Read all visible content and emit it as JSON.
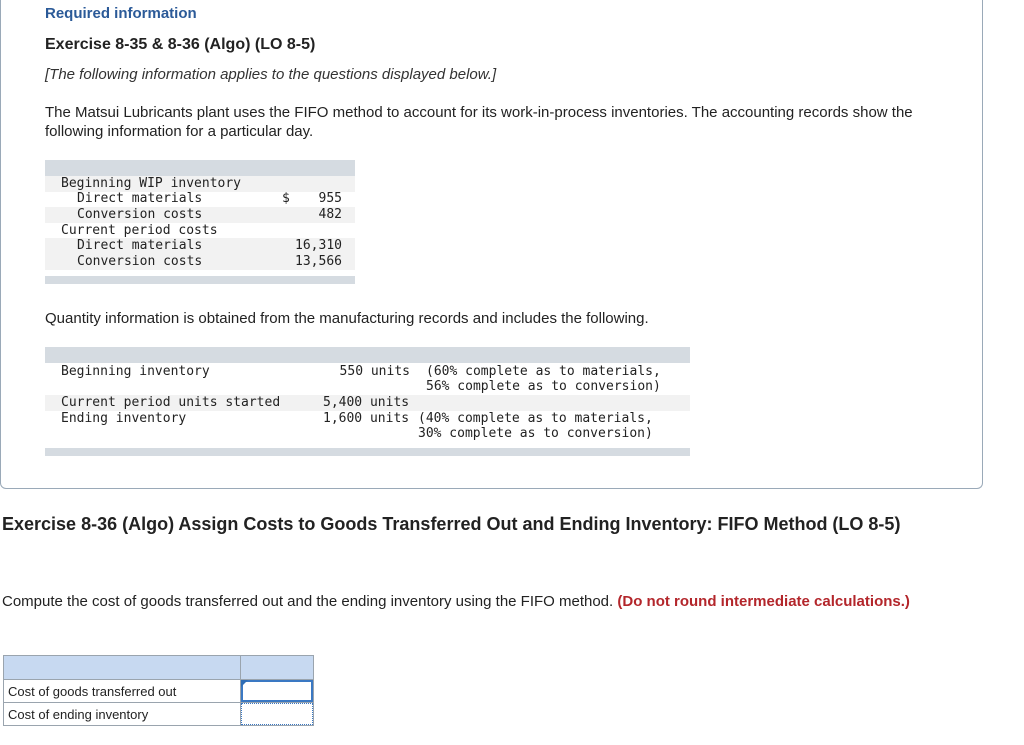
{
  "info": {
    "required_label": "Required information",
    "exercise_title": "Exercise 8-35 & 8-36 (Algo) (LO 8-5)",
    "applies_note": "[The following information applies to the questions displayed below.]",
    "intro": "The Matsui Lubricants plant uses the FIFO method to account for its work-in-process inventories. The accounting records show the following information for a particular day."
  },
  "cost_table": {
    "rows": [
      {
        "label": "Beginning WIP inventory",
        "currency": "",
        "value": ""
      },
      {
        "label": "Direct materials",
        "currency": "$",
        "value": "955"
      },
      {
        "label": "Conversion costs",
        "currency": "",
        "value": "482"
      },
      {
        "label": "Current period costs",
        "currency": "",
        "value": ""
      },
      {
        "label": "Direct materials",
        "currency": "",
        "value": "16,310"
      },
      {
        "label": "Conversion costs",
        "currency": "",
        "value": "13,566"
      }
    ]
  },
  "quantity_intro": "Quantity information is obtained from the manufacturing records and includes the following.",
  "qty_table": {
    "rows": [
      {
        "label": "Beginning inventory",
        "qty": "550 units",
        "note1": "(60% complete as to materials,",
        "note2": "56% complete as to conversion)"
      },
      {
        "label": "Current period units started",
        "qty": "5,400 units",
        "note1": "",
        "note2": ""
      },
      {
        "label": "Ending inventory",
        "qty": "1,600 units",
        "note1": "(40% complete as to materials,",
        "note2": "30% complete as to conversion)"
      }
    ]
  },
  "exercise2": {
    "title": "Exercise 8-36 (Algo) Assign Costs to Goods Transferred Out and Ending Inventory: FIFO Method (LO 8-5)",
    "instruction": "Compute the cost of goods transferred out and the ending inventory using the FIFO method.",
    "instruction_bold": "(Do not round intermediate calculations.)"
  },
  "answer_table": {
    "rows": [
      {
        "label": "Cost of goods transferred out",
        "value": ""
      },
      {
        "label": "Cost of ending inventory",
        "value": ""
      }
    ]
  },
  "colors": {
    "link_blue": "#2b5a98",
    "emphasis_red": "#b3262b",
    "table_header_blue": "#c7d9f1",
    "gray_bar": "#d5dbe1"
  }
}
